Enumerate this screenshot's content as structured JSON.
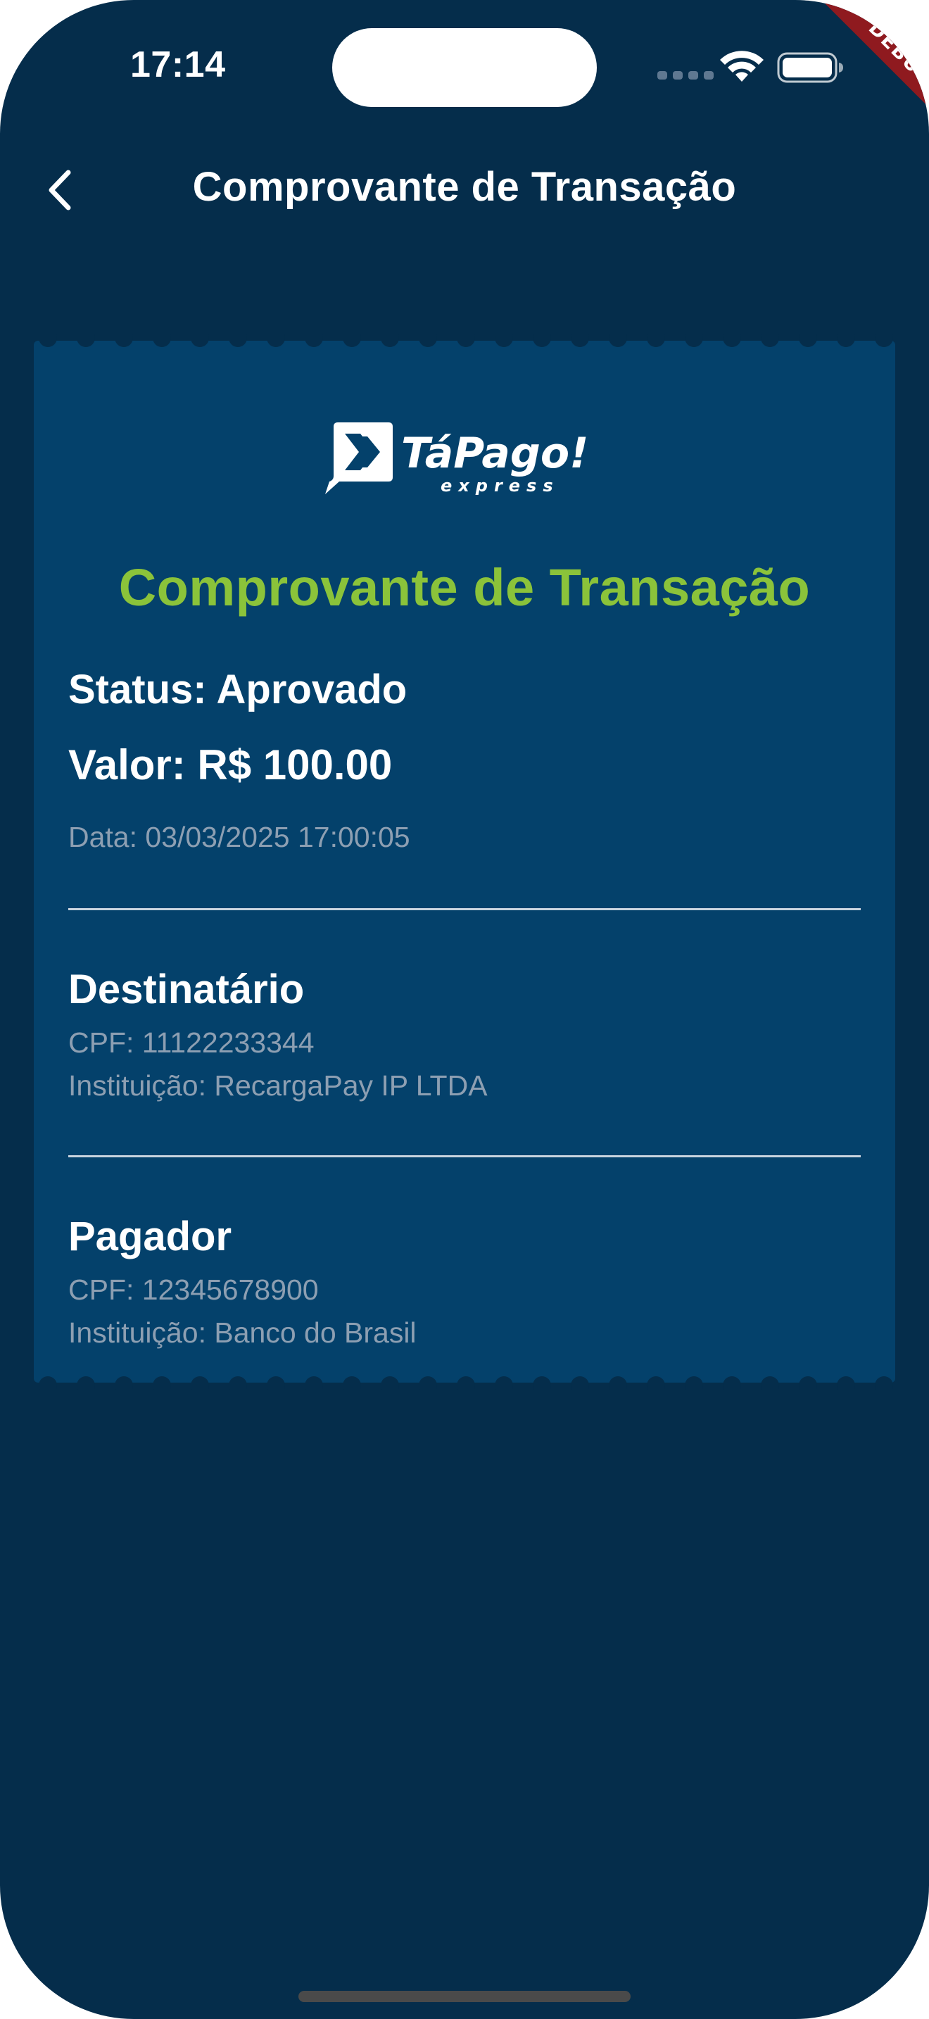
{
  "status_bar": {
    "time": "17:14"
  },
  "debug_banner": {
    "label": "DEBUG"
  },
  "app_bar": {
    "title": "Comprovante de Transação",
    "back_icon": "chevron-left-icon"
  },
  "receipt": {
    "logo": {
      "brand": "TáPago!",
      "tagline": "express"
    },
    "title": "Comprovante de Transação",
    "status": "Status: Aprovado",
    "amount": "Valor: R$ 100.00",
    "date": "Data: 03/03/2025 17:00:05",
    "recipient": {
      "heading": "Destinatário",
      "cpf": "CPF: 11122233344",
      "institution": "Instituição: RecargaPay IP LTDA"
    },
    "payer": {
      "heading": "Pagador",
      "cpf": "CPF: 12345678900",
      "institution": "Instituição: Banco do Brasil"
    }
  },
  "colors": {
    "background": "#052d4b",
    "card": "#04416b",
    "accent_green": "#8bc33a",
    "muted_text": "#8d9fb2",
    "debug_red": "#8f1a1f"
  }
}
